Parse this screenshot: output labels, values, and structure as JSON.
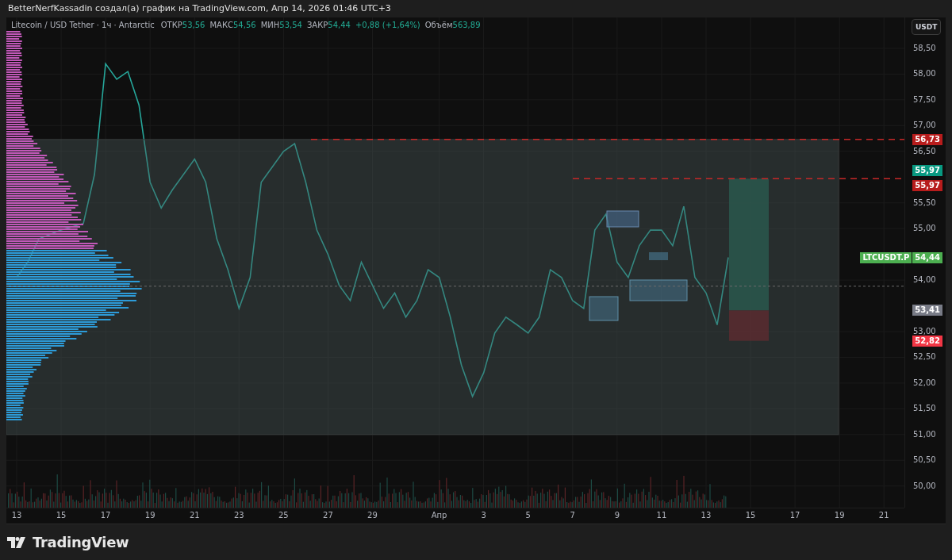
{
  "header": {
    "text": "BetterNerfKassadin создал(а) график на TradingView.com, Апр 14, 2026 01:46 UTC+3"
  },
  "legend": {
    "title": "Litecoin / USD Tether · 1ч · Antarctic",
    "fields": [
      {
        "label": "ОТКР",
        "value": "53,56"
      },
      {
        "label": "МАКС",
        "value": "54,56"
      },
      {
        "label": "МИН",
        "value": "53,54"
      },
      {
        "label": "ЗАКР",
        "value": "54,44"
      }
    ],
    "change": "+0,88 (+1,64%)",
    "volume": {
      "label": "Объём",
      "value": "563,89"
    }
  },
  "currency_button": "USDT",
  "chart": {
    "chart_data": {
      "type": "line",
      "grid": true,
      "xlim": [
        "2026-03-12T12:52",
        "2026-04-21T22:05"
      ],
      "ylim": [
        49.58,
        59.1
      ],
      "x": [
        "2026-03-13T00:00",
        "2026-03-13T12:00",
        "2026-03-14T00:00",
        "2026-03-15T00:00",
        "2026-03-16T00:00",
        "2026-03-16T12:00",
        "2026-03-17T00:00",
        "2026-03-17T12:00",
        "2026-03-18T00:00",
        "2026-03-18T12:00",
        "2026-03-19T00:00",
        "2026-03-19T12:00",
        "2026-03-20T00:00",
        "2026-03-21T00:00",
        "2026-03-21T12:00",
        "2026-03-22T00:00",
        "2026-03-22T12:00",
        "2026-03-23T00:00",
        "2026-03-23T12:00",
        "2026-03-24T00:00",
        "2026-03-24T12:00",
        "2026-03-25T00:00",
        "2026-03-25T12:00",
        "2026-03-26T00:00",
        "2026-03-26T12:00",
        "2026-03-27T00:00",
        "2026-03-27T12:00",
        "2026-03-28T00:00",
        "2026-03-28T12:00",
        "2026-03-29T00:00",
        "2026-03-29T12:00",
        "2026-03-30T00:00",
        "2026-03-30T12:00",
        "2026-03-31T00:00",
        "2026-03-31T12:00",
        "2026-04-01T00:00",
        "2026-04-01T12:00",
        "2026-04-02T00:00",
        "2026-04-02T12:00",
        "2026-04-03T00:00",
        "2026-04-03T12:00",
        "2026-04-04T00:00",
        "2026-04-04T12:00",
        "2026-04-05T00:00",
        "2026-04-05T12:00",
        "2026-04-06T00:00",
        "2026-04-06T12:00",
        "2026-04-07T00:00",
        "2026-04-07T12:00",
        "2026-04-08T00:00",
        "2026-04-08T12:00",
        "2026-04-09T00:00",
        "2026-04-09T12:00",
        "2026-04-10T00:00",
        "2026-04-10T12:00",
        "2026-04-11T00:00",
        "2026-04-11T12:00",
        "2026-04-12T00:00",
        "2026-04-12T12:00",
        "2026-04-13T00:00",
        "2026-04-13T12:00",
        "2026-04-14T00:00"
      ],
      "series": [
        {
          "name": "LTCUSDT.P",
          "color": "#26a69a",
          "values": [
            54.05,
            54.35,
            54.8,
            54.97,
            55.1,
            56.05,
            58.2,
            57.9,
            58.05,
            57.4,
            55.9,
            55.4,
            55.75,
            56.35,
            55.9,
            54.8,
            54.2,
            53.45,
            54.05,
            55.9,
            56.2,
            56.5,
            56.65,
            55.9,
            54.97,
            54.5,
            53.9,
            53.6,
            54.35,
            53.9,
            53.45,
            53.75,
            53.28,
            53.6,
            54.2,
            54.05,
            53.28,
            52.35,
            51.74,
            52.2,
            52.97,
            53.28,
            53.13,
            52.97,
            53.28,
            54.2,
            54.05,
            53.6,
            53.45,
            54.97,
            55.28,
            54.35,
            54.05,
            54.67,
            54.97,
            54.97,
            54.67,
            55.43,
            54.05,
            53.75,
            53.13,
            54.44
          ]
        }
      ],
      "xticks": [
        {
          "value": "2026-03-13",
          "label": "13"
        },
        {
          "value": "2026-03-15",
          "label": "15"
        },
        {
          "value": "2026-03-17",
          "label": "17"
        },
        {
          "value": "2026-03-19",
          "label": "19"
        },
        {
          "value": "2026-03-21",
          "label": "21"
        },
        {
          "value": "2026-03-23",
          "label": "23"
        },
        {
          "value": "2026-03-25",
          "label": "25"
        },
        {
          "value": "2026-03-27",
          "label": "27"
        },
        {
          "value": "2026-03-29",
          "label": "29"
        },
        {
          "value": "2026-04-01",
          "label": "Апр"
        },
        {
          "value": "2026-04-03",
          "label": "3"
        },
        {
          "value": "2026-04-05",
          "label": "5"
        },
        {
          "value": "2026-04-07",
          "label": "7"
        },
        {
          "value": "2026-04-09",
          "label": "9"
        },
        {
          "value": "2026-04-11",
          "label": "11"
        },
        {
          "value": "2026-04-13",
          "label": "13"
        },
        {
          "value": "2026-04-15",
          "label": "15"
        },
        {
          "value": "2026-04-17",
          "label": "17"
        },
        {
          "value": "2026-04-19",
          "label": "19"
        },
        {
          "value": "2026-04-21",
          "label": "21"
        }
      ],
      "yticks": [
        {
          "value": 58.5,
          "label": "58,50"
        },
        {
          "value": 58,
          "label": "58,00"
        },
        {
          "value": 57.5,
          "label": "57,50"
        },
        {
          "value": 57,
          "label": "57,00"
        },
        {
          "value": 56.5,
          "label": "56,50"
        },
        {
          "value": 55.5,
          "label": "55,50"
        },
        {
          "value": 55,
          "label": "55,00"
        },
        {
          "value": 54,
          "label": "54,00"
        },
        {
          "value": 53,
          "label": "53,00"
        },
        {
          "value": 52.5,
          "label": "52,50"
        },
        {
          "value": 52,
          "label": "52,00"
        },
        {
          "value": 51.5,
          "label": "51,50"
        },
        {
          "value": 51,
          "label": "51,00"
        },
        {
          "value": 50.5,
          "label": "50,50"
        },
        {
          "value": 50,
          "label": "50,00"
        }
      ]
    }
  },
  "price_tags": [
    {
      "label": "56,73",
      "color": "#b71c1c"
    },
    {
      "label": "55,97",
      "color": "#089981"
    },
    {
      "label": "55,97",
      "color": "#b71c1c"
    },
    {
      "label": "54,44",
      "color": "#4caf50"
    },
    {
      "label": "53,41",
      "color": "#787b86"
    },
    {
      "label": "52,82",
      "color": "#f23645"
    }
  ],
  "footer": {
    "logo": "TradingView"
  }
}
